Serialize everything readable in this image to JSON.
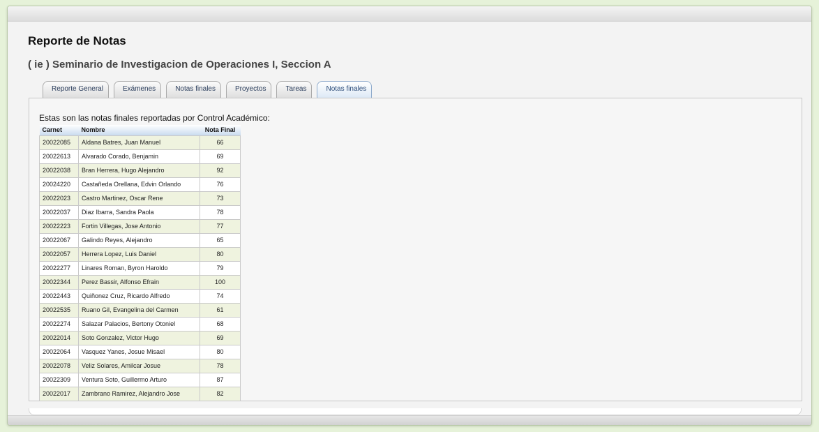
{
  "page_title": "Reporte de Notas",
  "course_title": "( ie ) Seminario de Investigacion de Operaciones I, Seccion A",
  "tabs": [
    {
      "label": "Reporte General"
    },
    {
      "label": "Exámenes"
    },
    {
      "label": "Notas finales"
    },
    {
      "label": "Proyectos"
    },
    {
      "label": "Tareas"
    },
    {
      "label": "Notas finales"
    }
  ],
  "active_tab_index": 5,
  "intro_text": "Estas son las notas finales reportadas por Control Académico:",
  "table": {
    "headers": [
      "Carnet",
      "Nombre",
      "Nota Final"
    ],
    "rows": [
      {
        "carnet": "20022085",
        "nombre": "Aldana Batres, Juan Manuel",
        "nota": "66"
      },
      {
        "carnet": "20022613",
        "nombre": "Alvarado Corado, Benjamin",
        "nota": "69"
      },
      {
        "carnet": "20022038",
        "nombre": "Bran Herrera, Hugo Alejandro",
        "nota": "92"
      },
      {
        "carnet": "20024220",
        "nombre": "Castañeda Orellana, Edvin Orlando",
        "nota": "76"
      },
      {
        "carnet": "20022023",
        "nombre": "Castro Martinez, Oscar Rene",
        "nota": "73"
      },
      {
        "carnet": "20022037",
        "nombre": "Diaz Ibarra, Sandra Paola",
        "nota": "78"
      },
      {
        "carnet": "20022223",
        "nombre": "Fortin Villegas, Jose Antonio",
        "nota": "77"
      },
      {
        "carnet": "20022067",
        "nombre": "Galindo Reyes, Alejandro",
        "nota": "65"
      },
      {
        "carnet": "20022057",
        "nombre": "Herrera Lopez, Luis Daniel",
        "nota": "80"
      },
      {
        "carnet": "20022277",
        "nombre": "Linares Roman, Byron Haroldo",
        "nota": "79"
      },
      {
        "carnet": "20022344",
        "nombre": "Perez Bassir, Alfonso Efrain",
        "nota": "100"
      },
      {
        "carnet": "20022443",
        "nombre": "Quiñonez Cruz, Ricardo Alfredo",
        "nota": "74"
      },
      {
        "carnet": "20022535",
        "nombre": "Ruano Gil, Evangelina del Carmen",
        "nota": "61"
      },
      {
        "carnet": "20022274",
        "nombre": "Salazar Palacios, Bertony Otoniel",
        "nota": "68"
      },
      {
        "carnet": "20022014",
        "nombre": "Soto Gonzalez, Victor Hugo",
        "nota": "69"
      },
      {
        "carnet": "20022064",
        "nombre": "Vasquez Yanes, Josue Misael",
        "nota": "80"
      },
      {
        "carnet": "20022078",
        "nombre": "Veliz Solares, Amilcar Josue",
        "nota": "78"
      },
      {
        "carnet": "20022309",
        "nombre": "Ventura Soto, Guillermo Arturo",
        "nota": "87"
      },
      {
        "carnet": "20022017",
        "nombre": "Zambrano Ramirez, Alejandro Jose",
        "nota": "82"
      }
    ]
  }
}
